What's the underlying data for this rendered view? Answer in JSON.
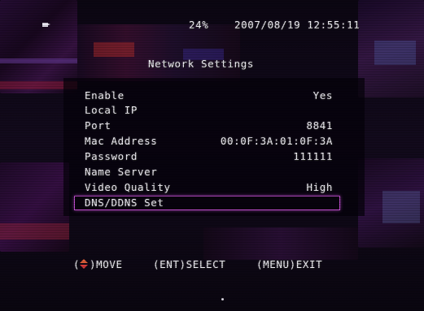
{
  "status_bar": {
    "percent": "24%",
    "datetime": "2007/08/19 12:55:11"
  },
  "menu": {
    "title": "Network Settings",
    "items": [
      {
        "label": "Enable",
        "value": "Yes"
      },
      {
        "label": "Local IP",
        "value": ""
      },
      {
        "label": "Port",
        "value": "8841"
      },
      {
        "label": "Mac Address",
        "value": "00:0F:3A:01:0F:3A"
      },
      {
        "label": "Password",
        "value": "111111"
      },
      {
        "label": "Name Server",
        "value": ""
      },
      {
        "label": "Video Quality",
        "value": "High"
      },
      {
        "label": "DNS/DDNS Set",
        "value": ""
      }
    ],
    "selected_item": "DNS/DDNS Set"
  },
  "footer": {
    "move_hint": ")MOVE",
    "move_open_paren": "(",
    "select_hint": "(ENT)SELECT",
    "exit_hint": "(MENU)EXIT"
  },
  "colors": {
    "highlight_border": "#c24fd0",
    "text": "#f0eef5",
    "arrow_up": "#e0603a",
    "arrow_down": "#d23a3a"
  },
  "icons": {
    "recording": "record-icon",
    "navigation": "up-down-arrow-icon"
  }
}
